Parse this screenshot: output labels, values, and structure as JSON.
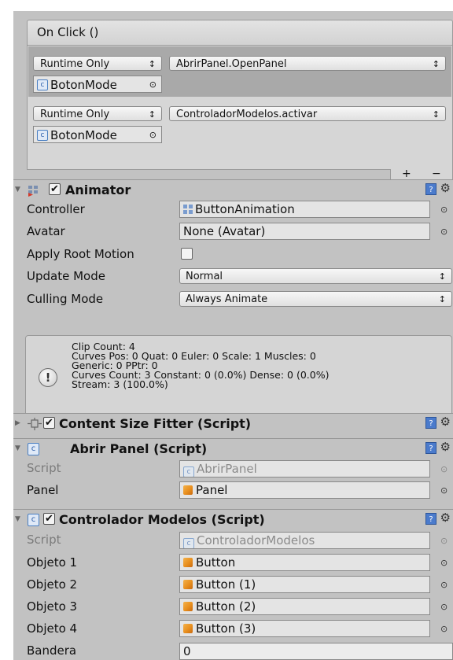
{
  "on_click": {
    "title": "On Click ()",
    "entries": [
      {
        "mode": "Runtime Only",
        "function": "AbrirPanel.OpenPanel",
        "object": "BotonMode"
      },
      {
        "mode": "Runtime Only",
        "function": "ControladorModelos.activar",
        "object": "BotonMode"
      }
    ],
    "add_label": "+",
    "remove_label": "−"
  },
  "animator": {
    "title": "Animator",
    "enabled": true,
    "props": {
      "controller_label": "Controller",
      "controller_value": "ButtonAnimation",
      "avatar_label": "Avatar",
      "avatar_value": "None (Avatar)",
      "apply_root_motion_label": "Apply Root Motion",
      "apply_root_motion_value": false,
      "update_mode_label": "Update Mode",
      "update_mode_value": "Normal",
      "culling_mode_label": "Culling Mode",
      "culling_mode_value": "Always Animate"
    },
    "info_lines": [
      "Clip Count: 4",
      "Curves Pos: 0 Quat: 0 Euler: 0 Scale: 1 Muscles: 0",
      "Generic: 0 PPtr: 0",
      "Curves Count: 3 Constant: 0 (0.0%) Dense: 0 (0.0%)",
      "Stream: 3 (100.0%)"
    ]
  },
  "content_size_fitter": {
    "title": "Content Size Fitter (Script)",
    "enabled": true
  },
  "abrir_panel": {
    "title": "Abrir Panel (Script)",
    "script_label": "Script",
    "script_value": "AbrirPanel",
    "panel_label": "Panel",
    "panel_value": "Panel"
  },
  "controlador_modelos": {
    "title": "Controlador Modelos (Script)",
    "enabled": true,
    "script_label": "Script",
    "script_value": "ControladorModelos",
    "objetos": [
      {
        "label": "Objeto 1",
        "value": "Button"
      },
      {
        "label": "Objeto 2",
        "value": "Button (1)"
      },
      {
        "label": "Objeto 3",
        "value": "Button (2)"
      },
      {
        "label": "Objeto 4",
        "value": "Button (3)"
      }
    ],
    "bandera_label": "Bandera",
    "bandera_value": "0"
  },
  "icons": {
    "help": "?",
    "gear": "⚙",
    "fold_open": "▼",
    "fold_closed": "▶",
    "check": "✔",
    "picker": "⊙",
    "dropdown": "↕",
    "info": "!"
  },
  "colors": {
    "inspector_bg": "#c2c2c2",
    "selected_entry": "#a9a9a9",
    "help_blue": "#4b7bcc",
    "prefab_orange": "#e88f1e"
  }
}
